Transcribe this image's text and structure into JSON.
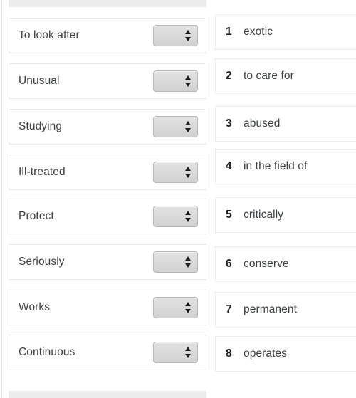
{
  "exercise": {
    "select_placeholder": "",
    "left_column": {
      "items": [
        {
          "label": "To look after",
          "selected": ""
        },
        {
          "label": "Unusual",
          "selected": ""
        },
        {
          "label": "Studying",
          "selected": ""
        },
        {
          "label": "Ill-treated",
          "selected": ""
        },
        {
          "label": "Protect",
          "selected": ""
        },
        {
          "label": "Seriously",
          "selected": ""
        },
        {
          "label": "Works",
          "selected": ""
        },
        {
          "label": "Continuous",
          "selected": ""
        }
      ]
    },
    "right_column": {
      "items": [
        {
          "num": "1",
          "text": "exotic"
        },
        {
          "num": "2",
          "text": "to care for"
        },
        {
          "num": "3",
          "text": "abused"
        },
        {
          "num": "4",
          "text": "in the field of"
        },
        {
          "num": "5",
          "text": "critically"
        },
        {
          "num": "6",
          "text": "conserve"
        },
        {
          "num": "7",
          "text": "permanent"
        },
        {
          "num": "8",
          "text": "operates"
        }
      ]
    }
  },
  "colors": {
    "card_border": "#e8e9ea",
    "answer_border": "#eceded",
    "text": "#3c4043",
    "num_text": "#202124",
    "gray_bar": "#ececec",
    "select_face": "#d9d9d9",
    "select_border": "#b7b7b7"
  }
}
